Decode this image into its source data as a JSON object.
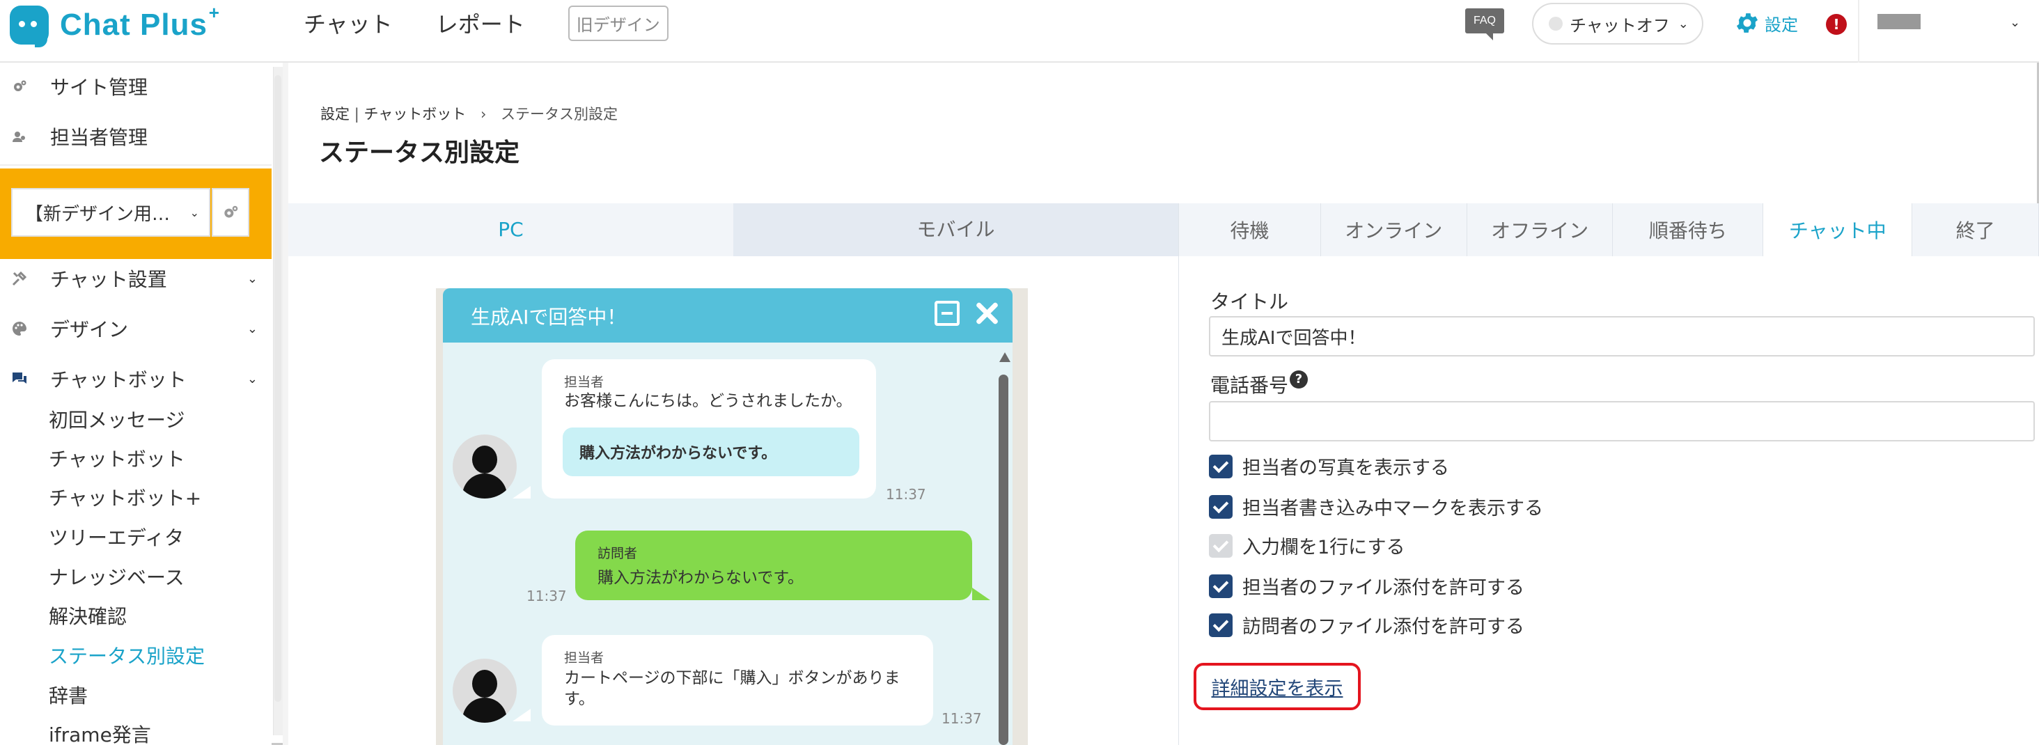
{
  "header": {
    "logo_text": "Chat Plus",
    "logo_sup": "+",
    "nav": [
      "チャット",
      "レポート"
    ],
    "old_design_label": "旧デザイン",
    "faq_label": "FAQ",
    "chat_status": "チャットオフ",
    "settings_label": "設定",
    "alert_label": "!"
  },
  "sidebar": {
    "top_items": [
      {
        "label": "サイト管理",
        "icon": "gear-icon"
      },
      {
        "label": "担当者管理",
        "icon": "users-icon"
      }
    ],
    "site_select": "【新デザイン用…",
    "sections": [
      {
        "label": "チャット設置",
        "icon": "tools-icon"
      },
      {
        "label": "デザイン",
        "icon": "palette-icon"
      },
      {
        "label": "チャットボット",
        "icon": "chat-icon"
      }
    ],
    "chatbot_items": [
      "初回メッセージ",
      "チャットボット",
      "チャットボット+",
      "ツリーエディタ",
      "ナレッジベース",
      "解決確認",
      "ステータス別設定",
      "辞書",
      "iframe発言"
    ],
    "active_item": "ステータス別設定"
  },
  "breadcrumb": {
    "items": [
      "設定",
      "チャットボット",
      "ステータス別設定"
    ]
  },
  "page_title": "ステータス別設定",
  "device_tabs": [
    "PC",
    "モバイル"
  ],
  "status_tabs": [
    "待機",
    "オンライン",
    "オフライン",
    "順番待ち",
    "チャット中",
    "終了"
  ],
  "active_status_tab": "チャット中",
  "form": {
    "title_label": "タイトル",
    "title_value": "生成AIで回答中！",
    "phone_label": "電話番号",
    "phone_value": "",
    "checkboxes": [
      {
        "label": "担当者の写真を表示する",
        "checked": true,
        "disabled": false
      },
      {
        "label": "担当者書き込み中マークを表示する",
        "checked": true,
        "disabled": false
      },
      {
        "label": "入力欄を1行にする",
        "checked": true,
        "disabled": true
      },
      {
        "label": "担当者のファイル添付を許可する",
        "checked": true,
        "disabled": false
      },
      {
        "label": "訪問者のファイル添付を許可する",
        "checked": true,
        "disabled": false
      }
    ],
    "detail_link": "詳細設定を表示"
  },
  "preview": {
    "title": "生成AIで回答中！",
    "messages": [
      {
        "sender": "担当者",
        "text": "お客様こんにちは。どうされましたか。",
        "quick_reply": "購入方法がわからないです。",
        "time": "11:37"
      },
      {
        "sender": "訪問者",
        "text": "購入方法がわからないです。",
        "time": "11:37"
      },
      {
        "sender": "担当者",
        "text_line1": "カートページの下部に「購入」ボタンがありま",
        "text_line2": "す。",
        "time": "11:37"
      }
    ]
  },
  "colors": {
    "accent": "#1aa3c9",
    "site_select_bg": "#f8ab00",
    "widget_header": "#55c0da",
    "visitor_bubble": "#84d94b",
    "checkbox": "#214678",
    "highlight_border": "#e4151f"
  }
}
